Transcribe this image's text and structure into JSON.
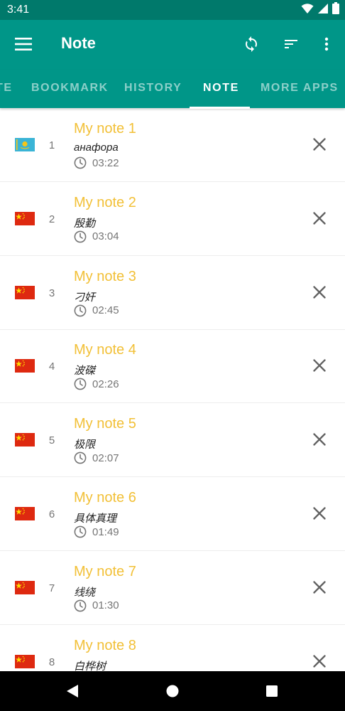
{
  "status_bar": {
    "time": "3:41",
    "icons": [
      "wifi-icon",
      "signal-icon",
      "battery-icon"
    ]
  },
  "app_bar": {
    "title": "Note",
    "actions": [
      "menu-icon",
      "sync-icon",
      "sort-icon",
      "more-vert-icon"
    ]
  },
  "tabs": [
    {
      "label": "TE",
      "active": false
    },
    {
      "label": "BOOKMARK",
      "active": false
    },
    {
      "label": "HISTORY",
      "active": false
    },
    {
      "label": "NOTE",
      "active": true
    },
    {
      "label": "MORE APPS",
      "active": false
    }
  ],
  "notes": [
    {
      "number": "1",
      "title": "My note 1",
      "subtitle": "анафора",
      "time": "03:22",
      "flag": "kz-flag-icon"
    },
    {
      "number": "2",
      "title": "My note 2",
      "subtitle": "殷勤",
      "time": "03:04",
      "flag": "cn-flag-icon"
    },
    {
      "number": "3",
      "title": "My note 3",
      "subtitle": "刁奸",
      "time": "02:45",
      "flag": "cn-flag-icon"
    },
    {
      "number": "4",
      "title": "My note 4",
      "subtitle": "波磔",
      "time": "02:26",
      "flag": "cn-flag-icon"
    },
    {
      "number": "5",
      "title": "My note 5",
      "subtitle": "极限",
      "time": "02:07",
      "flag": "cn-flag-icon"
    },
    {
      "number": "6",
      "title": "My note 6",
      "subtitle": "具体真理",
      "time": "01:49",
      "flag": "cn-flag-icon"
    },
    {
      "number": "7",
      "title": "My note 7",
      "subtitle": "线绕",
      "time": "01:30",
      "flag": "cn-flag-icon"
    },
    {
      "number": "8",
      "title": "My note 8",
      "subtitle": "白桦树",
      "time": "",
      "flag": "cn-flag-icon"
    }
  ],
  "nav_bar": {
    "buttons": [
      "back-icon",
      "home-icon",
      "recents-icon"
    ]
  },
  "colors": {
    "status_bar": "#00796b",
    "primary": "#009688",
    "title_accent": "#f2c037",
    "icon_gray": "#757575"
  }
}
